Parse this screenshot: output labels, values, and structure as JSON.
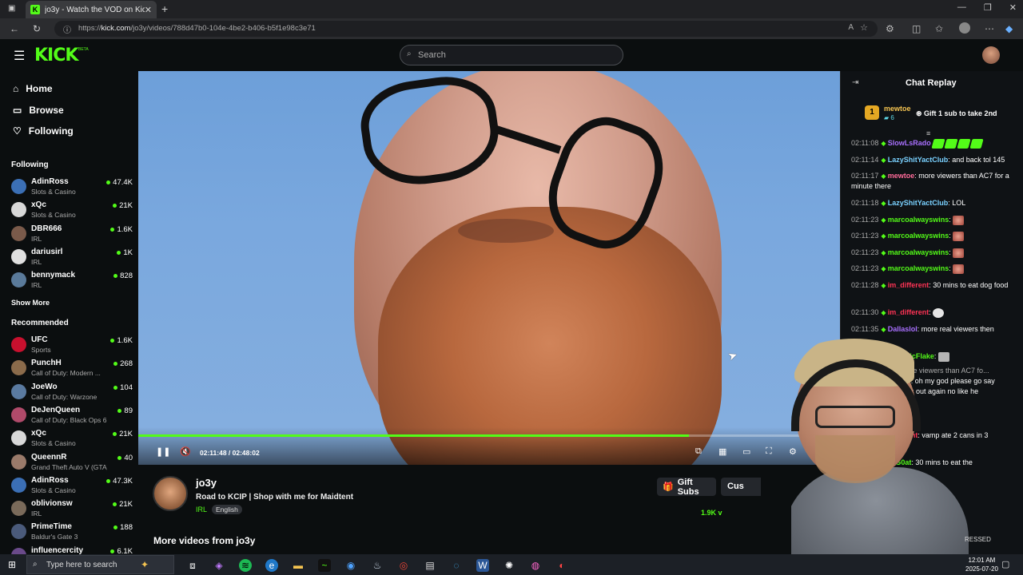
{
  "browser": {
    "tab_title": "jo3y - Watch the VOD on Kick",
    "tab_close": "✕",
    "new_tab": "+",
    "url_scheme": "https://",
    "url_host": "kick.com",
    "url_path": "/jo3y/videos/788d47b0-104e-4be2-b406-b5f1e98c3e71"
  },
  "header": {
    "logo": "KICK",
    "beta": "BETA",
    "search_placeholder": "Search"
  },
  "sidebar": {
    "nav": [
      {
        "label": "Home",
        "icon": "home-icon"
      },
      {
        "label": "Browse",
        "icon": "browse-icon"
      },
      {
        "label": "Following",
        "icon": "heart-icon"
      }
    ],
    "following_header": "Following",
    "following": [
      {
        "name": "AdinRoss",
        "category": "Slots & Casino",
        "viewers": "47.4K",
        "color": "#3b6fb5"
      },
      {
        "name": "xQc",
        "category": "Slots & Casino",
        "viewers": "21K",
        "color": "#d8d8d8"
      },
      {
        "name": "DBR666",
        "category": "IRL",
        "viewers": "1.6K",
        "color": "#7a5a4a"
      },
      {
        "name": "dariusirl",
        "category": "IRL",
        "viewers": "1K",
        "color": "#e0e0e0"
      },
      {
        "name": "bennymack",
        "category": "IRL",
        "viewers": "828",
        "color": "#5a7a9a"
      }
    ],
    "show_more": "Show More",
    "recommended_header": "Recommended",
    "recommended": [
      {
        "name": "UFC",
        "category": "Sports",
        "viewers": "1.6K",
        "color": "#c8102e"
      },
      {
        "name": "PunchH",
        "category": "Call of Duty: Modern ...",
        "viewers": "268",
        "color": "#8b6b4b"
      },
      {
        "name": "JoeWo",
        "category": "Call of Duty: Warzone",
        "viewers": "104",
        "color": "#5a7aa0"
      },
      {
        "name": "DeJenQueen",
        "category": "Call of Duty: Black Ops 6",
        "viewers": "89",
        "color": "#b04a6a"
      },
      {
        "name": "xQc",
        "category": "Slots & Casino",
        "viewers": "21K",
        "color": "#d8d8d8"
      },
      {
        "name": "QueennR",
        "category": "Grand Theft Auto V (GTA)",
        "viewers": "40",
        "color": "#9a7a6a"
      },
      {
        "name": "AdinRoss",
        "category": "Slots & Casino",
        "viewers": "47.3K",
        "color": "#3b6fb5"
      },
      {
        "name": "oblivionsw",
        "category": "IRL",
        "viewers": "21K",
        "color": "#7a6a5a"
      },
      {
        "name": "PrimeTime",
        "category": "Baldur's Gate 3",
        "viewers": "188",
        "color": "#4a5a7a"
      },
      {
        "name": "influencercity",
        "category": "",
        "viewers": "6.1K",
        "color": "#6a4a8a"
      }
    ]
  },
  "video": {
    "timecode": "02:11:48 / 02:48:02",
    "progress": 0.785
  },
  "stream": {
    "channel": "jo3y",
    "title": "Road to KCIP | Shop with me for Maidtent",
    "category": "IRL",
    "language": "English",
    "gift_subs": "Gift Subs",
    "customize": "Cus",
    "viewers": "1.9K v",
    "more_videos": "More videos from jo3y"
  },
  "chat": {
    "header": "Chat Replay",
    "pinned": {
      "rank": "1",
      "user": "mewtoe",
      "count": "6",
      "gift_text": "Gift 1 sub to take 2nd"
    },
    "messages": [
      {
        "ts": "02:11:08",
        "user": "SlowLsRado",
        "color": "#a970ff",
        "text": "",
        "emote": "green4"
      },
      {
        "ts": "02:11:14",
        "user": "LazyShitYactClub",
        "color": "#7ad1ff",
        "text": ": and back tol 145"
      },
      {
        "ts": "02:11:17",
        "user": "mewtoe",
        "color": "#ff6b9a",
        "text": ": more viewers than AC7 for a minute there"
      },
      {
        "ts": "02:11:18",
        "user": "LazyShitYactClub",
        "color": "#7ad1ff",
        "text": ": LOL"
      },
      {
        "ts": "02:11:23",
        "user": "marcoalwayswins",
        "color": "#53fc18",
        "text": ":",
        "emote": "face"
      },
      {
        "ts": "02:11:23",
        "user": "marcoalwayswins",
        "color": "#53fc18",
        "text": ":",
        "emote": "face"
      },
      {
        "ts": "02:11:23",
        "user": "marcoalwayswins",
        "color": "#53fc18",
        "text": ":",
        "emote": "face"
      },
      {
        "ts": "02:11:23",
        "user": "marcoalwayswins",
        "color": "#53fc18",
        "text": ":",
        "emote": "face"
      },
      {
        "ts": "02:11:28",
        "user": "im_different",
        "color": "#ff3355",
        "text": ": 30 mins to eat dog food"
      },
      {
        "ts": "02:11:30",
        "user": "im_different",
        "color": "#ff3355",
        "text": ":",
        "emote": "skull"
      },
      {
        "ts": "02:11:35",
        "user": "Dallaslol",
        "color": "#a970ff",
        "text": ": more real viewers then"
      },
      {
        "ts": "",
        "user": "MagicFlake",
        "color": "#53fc18",
        "text": ":",
        "emote": "cat"
      },
      {
        "ts": "",
        "user": "",
        "color": "#aaaaaa",
        "text": "ewtoe: more viewers than AC7 fo..."
      },
      {
        "ts": "",
        "user": "Wolf",
        "color": "#53fc18",
        "text": ": oh my god please go say"
      },
      {
        "ts": "",
        "user": "",
        "color": "#ffffff",
        "text": "crashes out again no like he"
      },
      {
        "ts": "",
        "user": "",
        "color": "#ff3355",
        "text": "",
        "emote": "red"
      },
      {
        "ts": "",
        "user": "fferent",
        "color": "#ff3355",
        "text": ": vamp ate 2 cans in 3"
      },
      {
        "ts": "",
        "user": "G0at",
        "color": "#53fc18",
        "text": ": 30 mins to eat the"
      }
    ],
    "pressed": "RESSED"
  },
  "taskbar": {
    "search_placeholder": "Type here to search",
    "time": "12:01 AM",
    "date": "2025-07-20"
  }
}
